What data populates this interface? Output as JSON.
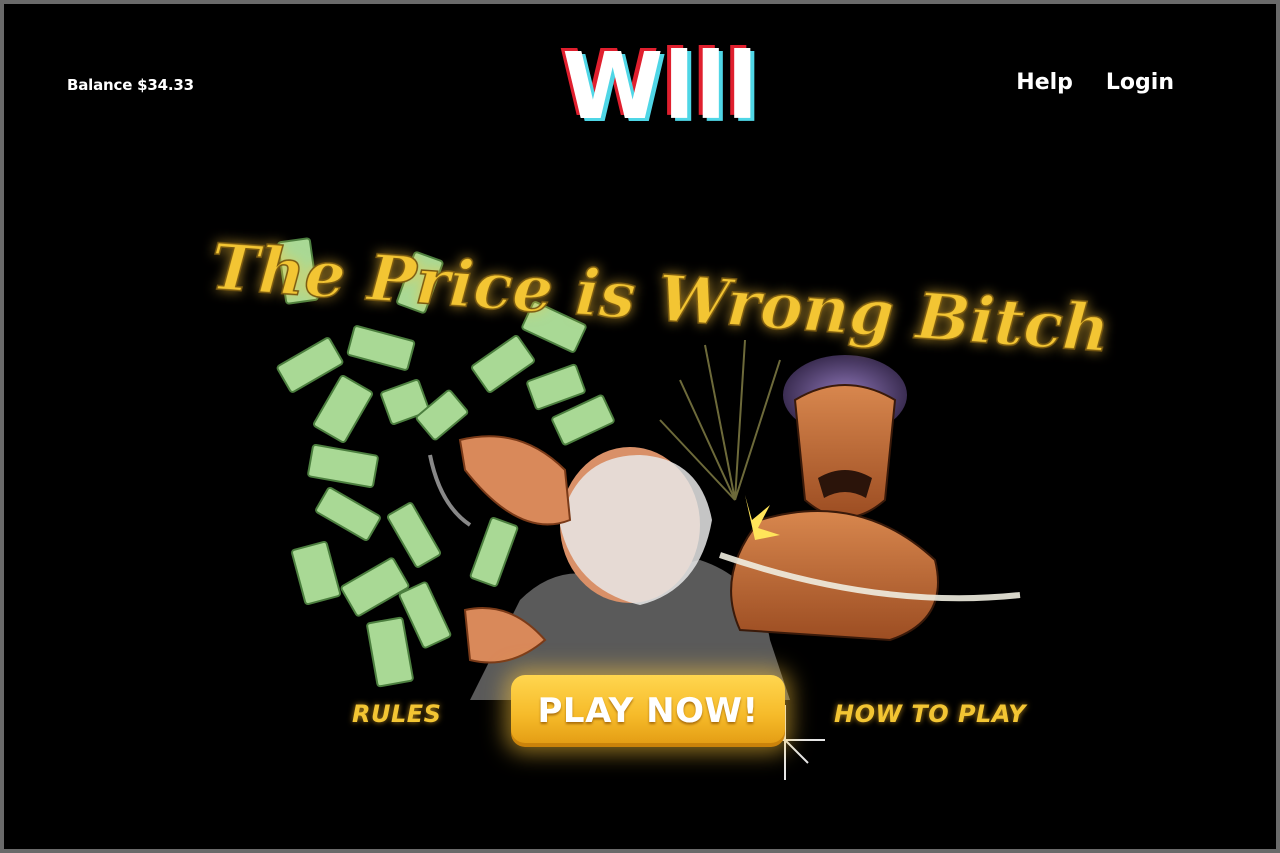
{
  "header": {
    "balance": "Balance $34.33",
    "logo_text": "Wlll",
    "nav": [
      {
        "label": "Help"
      },
      {
        "label": "Login"
      }
    ]
  },
  "hero": {
    "headline": "The Price is Wrong Bitch",
    "rules_label": "RULES",
    "play_label": "PLAY NOW!",
    "howto_label": "HOW TO PLAY"
  },
  "colors": {
    "background": "#000000",
    "accent_yellow": "#f3c533",
    "money_green": "#9fd48a",
    "logo_red": "#e01f2e",
    "logo_cyan": "#4fd6e6"
  }
}
